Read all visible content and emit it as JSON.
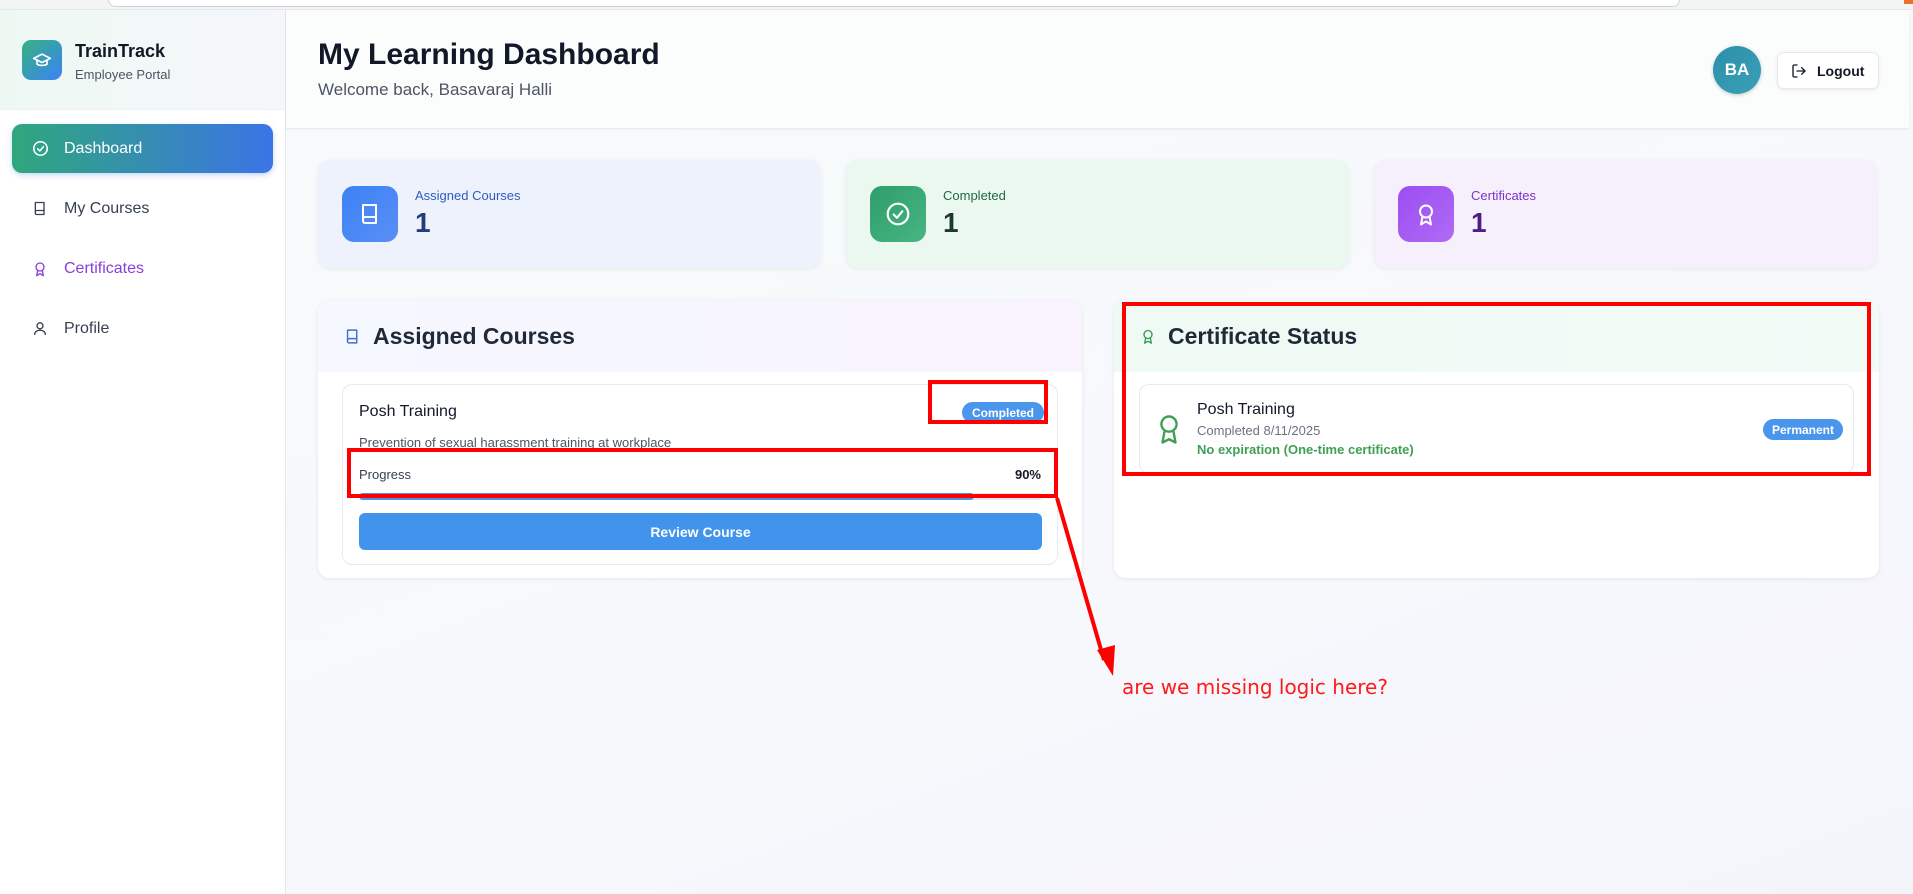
{
  "app": {
    "name": "TrainTrack",
    "subtitle": "Employee Portal"
  },
  "sidebar": {
    "items": [
      {
        "label": "Dashboard",
        "icon": "check-circle-icon",
        "active": true
      },
      {
        "label": "My Courses",
        "icon": "book-icon"
      },
      {
        "label": "Certificates",
        "icon": "award-icon"
      },
      {
        "label": "Profile",
        "icon": "user-icon"
      }
    ]
  },
  "header": {
    "title": "My Learning Dashboard",
    "welcome": "Welcome back, Basavaraj Halli",
    "avatar_initials": "BA",
    "logout_label": "Logout"
  },
  "stats": [
    {
      "label": "Assigned Courses",
      "value": "1",
      "icon": "book-icon"
    },
    {
      "label": "Completed",
      "value": "1",
      "icon": "check-circle-icon"
    },
    {
      "label": "Certificates",
      "value": "1",
      "icon": "award-icon"
    }
  ],
  "assigned_courses": {
    "heading": "Assigned Courses",
    "courses": [
      {
        "title": "Posh Training",
        "status": "Completed",
        "description": "Prevention of sexual harassment training at workplace",
        "progress_label": "Progress",
        "progress_value": "90%",
        "progress_fraction": 0.9,
        "button_label": "Review Course"
      }
    ]
  },
  "certificate_status": {
    "heading": "Certificate Status",
    "certificates": [
      {
        "title": "Posh Training",
        "completed": "Completed 8/11/2025",
        "expiration": "No expiration (One-time certificate)",
        "badge": "Permanent"
      }
    ]
  },
  "annotation": {
    "text": "are we missing logic here?",
    "color": "#ff0000"
  },
  "colors": {
    "accent_blue": "#4193ec",
    "accent_green": "#2fa77c",
    "accent_purple": "#8b3fd9"
  }
}
